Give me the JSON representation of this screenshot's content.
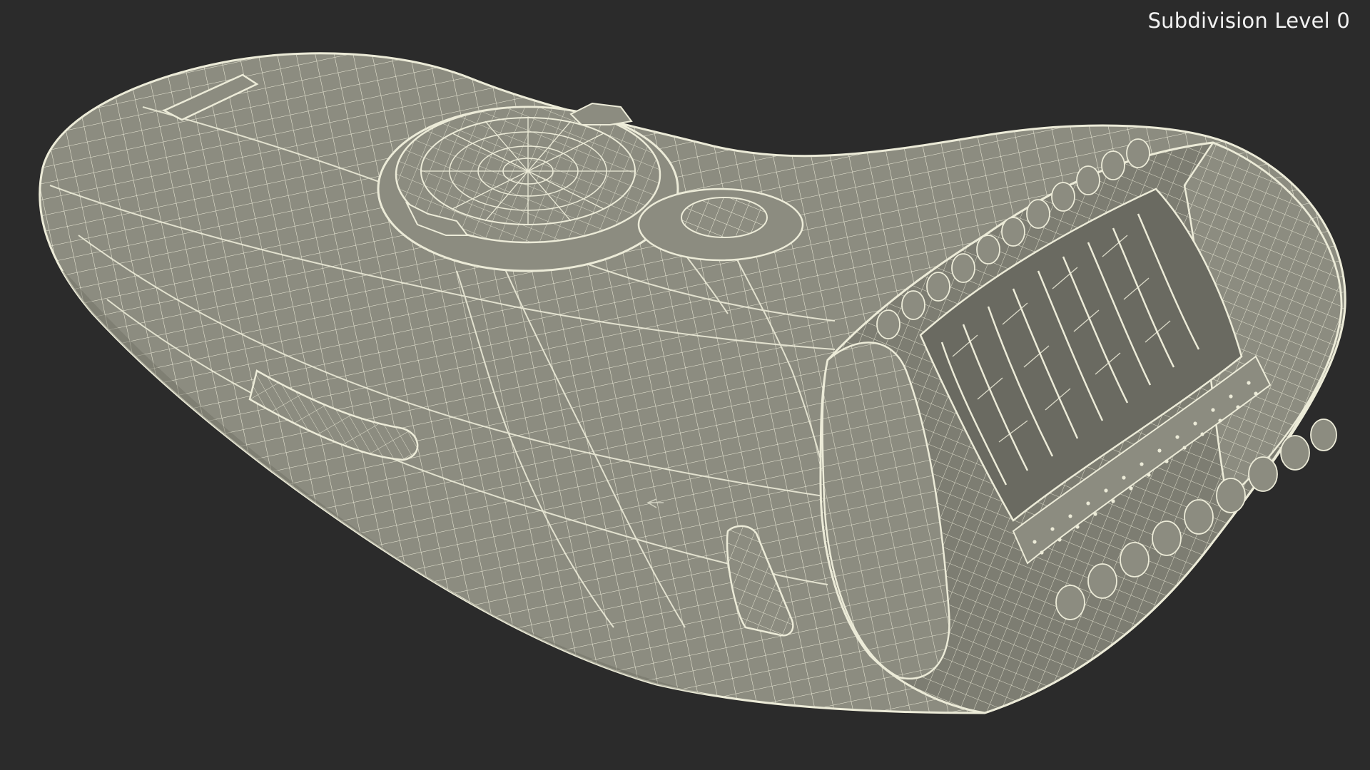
{
  "viewport": {
    "subdivision_label": "Subdivision Level 0"
  },
  "colors": {
    "background": "#2b2b2b",
    "surface": "#8c8c80",
    "surface_dark": "#6e6e64",
    "wire": "#ecebd8",
    "label_text": "#f2f2f2"
  },
  "model": {
    "icon": "epilator-wireframe-icon"
  }
}
